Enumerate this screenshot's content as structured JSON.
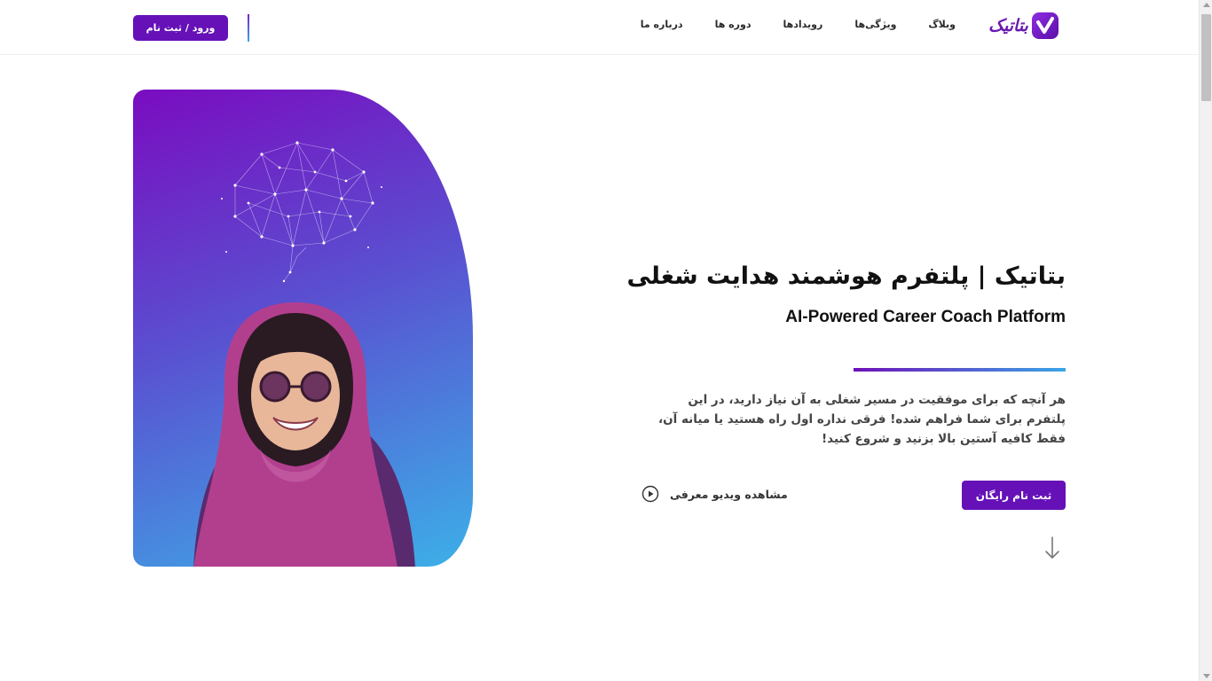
{
  "header": {
    "logo_text": "بتاتیک",
    "nav": [
      {
        "label": "درباره ما"
      },
      {
        "label": "دوره ها"
      },
      {
        "label": "رویدادها"
      },
      {
        "label": "ویژگی‌ها"
      },
      {
        "label": "وبلاگ"
      }
    ],
    "login_label": "ورود / ثبت نام"
  },
  "hero": {
    "title": "بتاتیک | پلتفرم هوشمند هدایت شغلی",
    "subtitle": "AI-Powered Career Coach Platform",
    "description": "هر آنچه که برای موفقیت در مسیر شغلی به آن نیاز دارید، در این پلتفرم برای شما فراهم شده! فرقی نداره اول راه هستید یا میانه آن، فقط کافیه آستین بالا بزنید و شروع کنید!",
    "cta_label": "ثبت نام رایگان",
    "video_label": "مشاهده ویدیو معرفی"
  },
  "colors": {
    "brand": "#6611b8",
    "gradient_start": "#7a0cc0",
    "gradient_end": "#3cb0e8"
  },
  "icons": {
    "logo": "check-heart-logo-icon",
    "play": "play-circle-icon",
    "scroll": "arrow-down-icon"
  }
}
